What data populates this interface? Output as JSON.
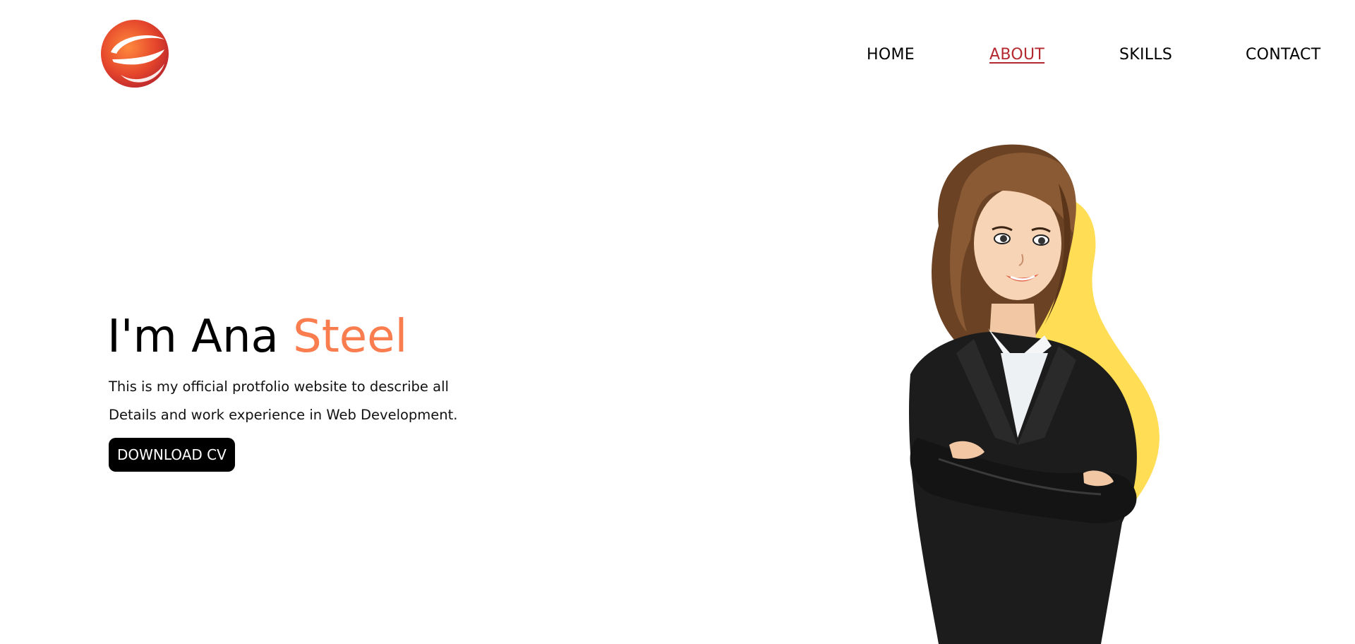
{
  "header": {
    "logo_icon": "swirl-e-logo-icon",
    "nav": [
      {
        "label": "HOME",
        "active": false
      },
      {
        "label": "ABOUT",
        "active": true
      },
      {
        "label": "SKILLS",
        "active": false
      },
      {
        "label": "CONTACT",
        "active": false
      }
    ]
  },
  "hero": {
    "title_prefix": "I'm Ana ",
    "title_accent": "Steel",
    "description_line1": "This is my official protfolio website to describe all",
    "description_line2": "Details and work experience in Web Development.",
    "cta_label": "DOWNLOAD CV",
    "illustration_icon": "businesswoman-illustration"
  },
  "colors": {
    "accent_orange": "#fa7d4f",
    "active_nav": "#b4292f",
    "blob_yellow": "#ffdd55",
    "button_bg": "#000000",
    "button_text": "#ffffff"
  }
}
